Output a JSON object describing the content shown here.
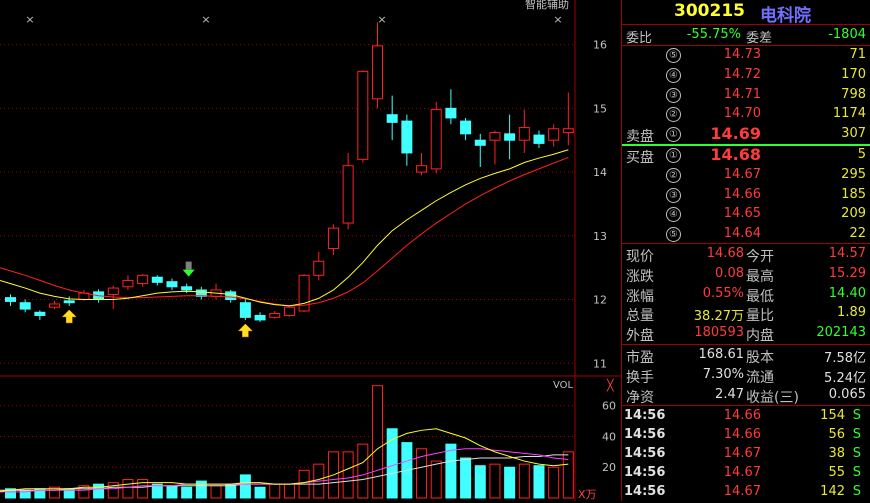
{
  "stock": {
    "code": "300215",
    "name": "电科院"
  },
  "chart_header": {
    "smart_aid": "智能辅助",
    "vol_label": "VOL",
    "vol_unit": "X万",
    "close_x": "╳",
    "markers": [
      "×",
      "×",
      "×",
      "×"
    ]
  },
  "price_axis": [
    "16",
    "15",
    "14",
    "13",
    "12",
    "11"
  ],
  "vol_axis": [
    "60",
    "40",
    "20"
  ],
  "order_book": {
    "weibi_label": "委比",
    "weibi": "-55.75%",
    "weicha_label": "委差",
    "weicha": "-1804",
    "sell_label": "卖盘",
    "buy_label": "买盘",
    "asks": [
      {
        "lvl": "⑤",
        "price": "14.73",
        "vol": "71"
      },
      {
        "lvl": "④",
        "price": "14.72",
        "vol": "170"
      },
      {
        "lvl": "③",
        "price": "14.71",
        "vol": "798"
      },
      {
        "lvl": "②",
        "price": "14.70",
        "vol": "1174"
      },
      {
        "lvl": "①",
        "price": "14.69",
        "vol": "307"
      }
    ],
    "bids": [
      {
        "lvl": "①",
        "price": "14.68",
        "vol": "5"
      },
      {
        "lvl": "②",
        "price": "14.67",
        "vol": "295"
      },
      {
        "lvl": "③",
        "price": "14.66",
        "vol": "185"
      },
      {
        "lvl": "④",
        "price": "14.65",
        "vol": "209"
      },
      {
        "lvl": "⑤",
        "price": "14.64",
        "vol": "22"
      }
    ]
  },
  "quote": [
    {
      "l1": "现价",
      "v1": "14.68",
      "c1": "red",
      "l2": "今开",
      "v2": "14.57",
      "c2": "red"
    },
    {
      "l1": "涨跌",
      "v1": "0.08",
      "c1": "red",
      "l2": "最高",
      "v2": "15.29",
      "c2": "red"
    },
    {
      "l1": "涨幅",
      "v1": "0.55%",
      "c1": "red",
      "l2": "最低",
      "v2": "14.40",
      "c2": "grn"
    },
    {
      "l1": "总量",
      "v1": "38.27万",
      "c1": "yel",
      "l2": "量比",
      "v2": "1.89",
      "c2": "yel"
    },
    {
      "l1": "外盘",
      "v1": "180593",
      "c1": "red",
      "l2": "内盘",
      "v2": "202143",
      "c2": "grn"
    }
  ],
  "fundamentals": [
    {
      "l1": "市盈",
      "v1": "168.61",
      "l2": "股本",
      "v2": "7.58亿"
    },
    {
      "l1": "换手",
      "v1": "7.30%",
      "l2": "流通",
      "v2": "5.24亿"
    },
    {
      "l1": "净资",
      "v1": "2.47",
      "l2": "收益(三)",
      "v2": "0.065"
    }
  ],
  "ticks": [
    {
      "time": "14:56",
      "price": "14.66",
      "vol": "154",
      "side": "S"
    },
    {
      "time": "14:56",
      "price": "14.66",
      "vol": "56",
      "side": "S"
    },
    {
      "time": "14:56",
      "price": "14.67",
      "vol": "38",
      "side": "S"
    },
    {
      "time": "14:56",
      "price": "14.67",
      "vol": "55",
      "side": "S"
    },
    {
      "time": "14:56",
      "price": "14.67",
      "vol": "142",
      "side": "S"
    }
  ],
  "chart_data": {
    "type": "candlestick",
    "ylim": [
      10.8,
      16.7
    ],
    "vol_ylim": [
      0,
      78
    ],
    "candles": [
      {
        "o": 12.03,
        "c": 11.97,
        "h": 12.08,
        "l": 11.9,
        "v": 6
      },
      {
        "o": 11.95,
        "c": 11.85,
        "h": 12.0,
        "l": 11.8,
        "v": 5
      },
      {
        "o": 11.8,
        "c": 11.75,
        "h": 11.83,
        "l": 11.68,
        "v": 6
      },
      {
        "o": 11.88,
        "c": 11.93,
        "h": 11.98,
        "l": 11.85,
        "v": 7
      },
      {
        "o": 11.98,
        "c": 11.95,
        "h": 12.05,
        "l": 11.9,
        "v": 6
      },
      {
        "o": 12.0,
        "c": 12.1,
        "h": 12.15,
        "l": 11.98,
        "v": 8
      },
      {
        "o": 12.12,
        "c": 12.0,
        "h": 12.16,
        "l": 11.95,
        "v": 9
      },
      {
        "o": 12.08,
        "c": 12.18,
        "h": 12.22,
        "l": 11.85,
        "v": 10
      },
      {
        "o": 12.2,
        "c": 12.3,
        "h": 12.38,
        "l": 12.15,
        "v": 12
      },
      {
        "o": 12.25,
        "c": 12.38,
        "h": 12.4,
        "l": 12.2,
        "v": 12
      },
      {
        "o": 12.35,
        "c": 12.27,
        "h": 12.38,
        "l": 12.22,
        "v": 9
      },
      {
        "o": 12.28,
        "c": 12.2,
        "h": 12.33,
        "l": 12.15,
        "v": 8
      },
      {
        "o": 12.2,
        "c": 12.15,
        "h": 12.25,
        "l": 12.1,
        "v": 7
      },
      {
        "o": 12.15,
        "c": 12.05,
        "h": 12.2,
        "l": 12.0,
        "v": 11
      },
      {
        "o": 12.05,
        "c": 12.15,
        "h": 12.25,
        "l": 12.0,
        "v": 8
      },
      {
        "o": 12.12,
        "c": 12.0,
        "h": 12.15,
        "l": 11.95,
        "v": 9
      },
      {
        "o": 11.95,
        "c": 11.72,
        "h": 12.0,
        "l": 11.68,
        "v": 15
      },
      {
        "o": 11.75,
        "c": 11.68,
        "h": 11.8,
        "l": 11.65,
        "v": 7
      },
      {
        "o": 11.72,
        "c": 11.78,
        "h": 11.82,
        "l": 11.7,
        "v": 9
      },
      {
        "o": 11.75,
        "c": 11.88,
        "h": 11.9,
        "l": 11.73,
        "v": 9
      },
      {
        "o": 11.82,
        "c": 12.38,
        "h": 12.4,
        "l": 11.8,
        "v": 18
      },
      {
        "o": 12.38,
        "c": 12.6,
        "h": 12.75,
        "l": 12.3,
        "v": 22
      },
      {
        "o": 12.8,
        "c": 13.12,
        "h": 13.18,
        "l": 12.7,
        "v": 30
      },
      {
        "o": 13.2,
        "c": 14.1,
        "h": 14.3,
        "l": 13.1,
        "v": 30
      },
      {
        "o": 14.2,
        "c": 15.58,
        "h": 15.6,
        "l": 14.15,
        "v": 35
      },
      {
        "o": 15.15,
        "c": 15.98,
        "h": 16.35,
        "l": 15.0,
        "v": 73
      },
      {
        "o": 14.9,
        "c": 14.78,
        "h": 15.2,
        "l": 14.5,
        "v": 45
      },
      {
        "o": 14.8,
        "c": 14.3,
        "h": 14.9,
        "l": 14.1,
        "v": 36
      },
      {
        "o": 14.0,
        "c": 14.1,
        "h": 14.3,
        "l": 13.95,
        "v": 32
      },
      {
        "o": 14.05,
        "c": 14.98,
        "h": 15.1,
        "l": 13.98,
        "v": 24
      },
      {
        "o": 15.0,
        "c": 14.85,
        "h": 15.3,
        "l": 14.75,
        "v": 35
      },
      {
        "o": 14.8,
        "c": 14.6,
        "h": 14.85,
        "l": 14.5,
        "v": 26
      },
      {
        "o": 14.5,
        "c": 14.42,
        "h": 14.6,
        "l": 14.08,
        "v": 21
      },
      {
        "o": 14.5,
        "c": 14.62,
        "h": 14.65,
        "l": 14.12,
        "v": 22
      },
      {
        "o": 14.6,
        "c": 14.5,
        "h": 14.9,
        "l": 14.2,
        "v": 20
      },
      {
        "o": 14.5,
        "c": 14.7,
        "h": 14.98,
        "l": 14.3,
        "v": 22
      },
      {
        "o": 14.58,
        "c": 14.45,
        "h": 14.65,
        "l": 14.38,
        "v": 21
      },
      {
        "o": 14.5,
        "c": 14.68,
        "h": 14.75,
        "l": 14.4,
        "v": 20
      },
      {
        "o": 14.62,
        "c": 14.68,
        "h": 15.25,
        "l": 14.42,
        "v": 30
      }
    ],
    "ma_yellow": [
      12.25,
      12.18,
      12.1,
      12.05,
      12.01,
      12.0,
      12.0,
      12.0,
      12.02,
      12.06,
      12.1,
      12.12,
      12.13,
      12.12,
      12.1,
      12.08,
      12.02,
      11.96,
      11.92,
      11.9,
      11.94,
      12.02,
      12.15,
      12.35,
      12.58,
      12.85,
      13.08,
      13.25,
      13.4,
      13.55,
      13.68,
      13.8,
      13.9,
      13.98,
      14.05,
      14.15,
      14.22,
      14.28,
      14.35
    ],
    "ma_red": [
      12.45,
      12.38,
      12.3,
      12.22,
      12.15,
      12.1,
      12.06,
      12.04,
      12.03,
      12.03,
      12.04,
      12.05,
      12.06,
      12.06,
      12.05,
      12.04,
      12.01,
      11.97,
      11.93,
      11.9,
      11.91,
      11.95,
      12.02,
      12.12,
      12.26,
      12.45,
      12.65,
      12.85,
      13.03,
      13.2,
      13.35,
      13.5,
      13.63,
      13.75,
      13.86,
      13.96,
      14.05,
      14.14,
      14.23
    ],
    "vol_ma_yellow": [
      5,
      6,
      6,
      6,
      6,
      7,
      7,
      8,
      9,
      10,
      10,
      10,
      9,
      9,
      9,
      9,
      10,
      10,
      9,
      9,
      10,
      12,
      15,
      19,
      23,
      32,
      38,
      42,
      44,
      45,
      42,
      39,
      34,
      30,
      27,
      24,
      22,
      21,
      22
    ],
    "vol_ma_magenta": [
      4,
      4,
      5,
      5,
      5,
      5,
      6,
      6,
      7,
      8,
      8,
      8,
      9,
      9,
      9,
      9,
      9,
      9,
      9,
      9,
      10,
      11,
      12,
      13,
      15,
      18,
      21,
      24,
      27,
      29,
      31,
      32,
      32,
      31,
      30,
      29,
      28,
      26,
      25
    ],
    "vol_ma_white": [
      5,
      5,
      5,
      5,
      6,
      6,
      6,
      7,
      7,
      7,
      8,
      8,
      8,
      8,
      8,
      8,
      9,
      9,
      9,
      9,
      9,
      9,
      10,
      11,
      12,
      14,
      16,
      18,
      20,
      22,
      24,
      25,
      26,
      26,
      26,
      27,
      27,
      28,
      28
    ],
    "up_markers": [
      4,
      16
    ],
    "down_markers": [
      12
    ]
  }
}
